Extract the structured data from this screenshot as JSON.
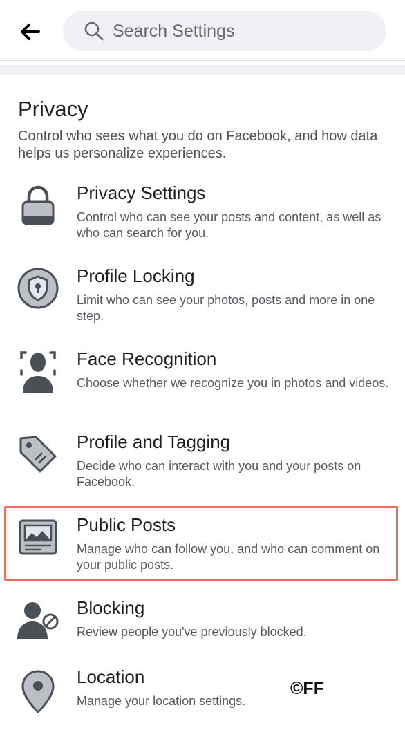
{
  "header": {
    "search_placeholder": "Search Settings"
  },
  "section": {
    "title": "Privacy",
    "description": "Control who sees what you do on Facebook, and how data helps us personalize experiences."
  },
  "items": [
    {
      "title": "Privacy Settings",
      "description": "Control who can see your posts and content, as well as who can search for you.",
      "icon": "lock-icon"
    },
    {
      "title": "Profile Locking",
      "description": "Limit who can see your photos, posts and more in one step.",
      "icon": "shield-lock-icon"
    },
    {
      "title": "Face Recognition",
      "description": "Choose whether we recognize you in photos and videos.",
      "icon": "face-scan-icon"
    },
    {
      "title": "Profile and Tagging",
      "description": "Decide who can interact with you and your posts on Facebook.",
      "icon": "tag-icon"
    },
    {
      "title": "Public Posts",
      "description": "Manage who can follow you, and who can comment on your public posts.",
      "icon": "public-posts-icon"
    },
    {
      "title": "Blocking",
      "description": "Review people you've previously blocked.",
      "icon": "blocked-person-icon"
    },
    {
      "title": "Location",
      "description": "Manage your location settings.",
      "icon": "location-pin-icon"
    }
  ],
  "watermark": "©FF",
  "colors": {
    "highlight": "#f16a5d",
    "icon_fill": "#bcc0c4",
    "icon_dark": "#4b4f56"
  }
}
